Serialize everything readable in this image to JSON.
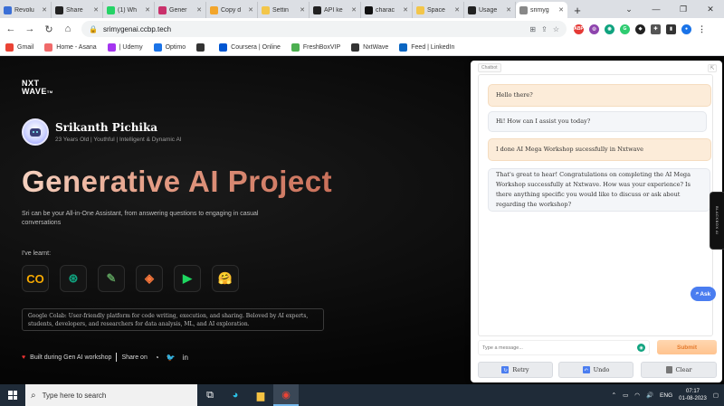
{
  "browser": {
    "tabs": [
      {
        "label": "Revolu",
        "color": "#3b6fd6"
      },
      {
        "label": "Share",
        "color": "#222222"
      },
      {
        "label": "(1) Wh",
        "color": "#25d366"
      },
      {
        "label": "Gener",
        "color": "#c9306b"
      },
      {
        "label": "Copy d",
        "color": "#f2a52b"
      },
      {
        "label": "Settin",
        "color": "#f3c64a"
      },
      {
        "label": "API ke",
        "color": "#222222"
      },
      {
        "label": "charac",
        "color": "#111111"
      },
      {
        "label": "Space",
        "color": "#f3c64a"
      },
      {
        "label": "Usage",
        "color": "#222222"
      },
      {
        "label": "srimyg",
        "color": "#888888"
      }
    ],
    "new_tab": "+",
    "url": "srimygenai.ccbp.tech",
    "bookmarks": [
      {
        "label": "Gmail",
        "color": "#ea4335"
      },
      {
        "label": "Home - Asana",
        "color": "#f06a6a"
      },
      {
        "label": "| Udemy",
        "color": "#a435f0"
      },
      {
        "label": "Optimo",
        "color": "#1a73e8"
      },
      {
        "label": "",
        "color": "#333333"
      },
      {
        "label": "Coursera | Online",
        "color": "#0056d2"
      },
      {
        "label": "FreshBoxVIP",
        "color": "#4caf50"
      },
      {
        "label": "NxtWave",
        "color": "#333333"
      },
      {
        "label": "Feed | LinkedIn",
        "color": "#0a66c2"
      }
    ]
  },
  "page": {
    "logo_line1": "NXT",
    "logo_line2": "WAVE",
    "logo_tm": "TM",
    "name": "Srikanth Pichika",
    "tagline": "23 Years Old | Youthful | Intelligent & Dynamic AI",
    "headline": "Generative AI Project",
    "description": "Sri can be your All-in-One Assistant, from answering questions to engaging in casual conversations",
    "learnt_label": "I've learnt:",
    "tools": [
      {
        "glyph": "CO",
        "color": "#f9ab00"
      },
      {
        "glyph": "⊛",
        "color": "#10a37f"
      },
      {
        "glyph": "✎",
        "color": "#5a9a5a"
      },
      {
        "glyph": "◈",
        "color": "#ff7a3d"
      },
      {
        "glyph": "▶",
        "color": "#1ed760"
      },
      {
        "glyph": "🤗",
        "color": "#ffd21e"
      }
    ],
    "info_text": "Google Colab: User-friendly platform for code writing, execution, and sharing. Beloved by AI experts, students, developers, and researchers for data analysis, ML, and AI exploration.",
    "footer_built": "Built during Gen AI workshop",
    "footer_share": "Share on"
  },
  "chatbot": {
    "label": "Chatbot",
    "messages": [
      {
        "role": "user",
        "text": "Hello there?"
      },
      {
        "role": "bot",
        "text": "Hi! How can I assist you today?"
      },
      {
        "role": "user",
        "text": "I done AI Mega Workshop sucessfully in Nxtwave"
      },
      {
        "role": "bot",
        "text": "That's great to hear! Congratulations on completing the AI Mega Workshop successfully at Nxtwave. How was your experience? Is there anything specific you would like to discuss or ask about regarding the workshop?"
      }
    ],
    "ask_label": "Ask",
    "input_placeholder": "Type a message...",
    "submit_label": "Submit",
    "retry_label": "Retry",
    "undo_label": "Undo",
    "clear_label": "Clear"
  },
  "side_tab": "BLACKBOX AI",
  "taskbar": {
    "search_placeholder": "Type here to search",
    "lang": "ENG",
    "time": "07:17",
    "date": "01-08-2023"
  }
}
